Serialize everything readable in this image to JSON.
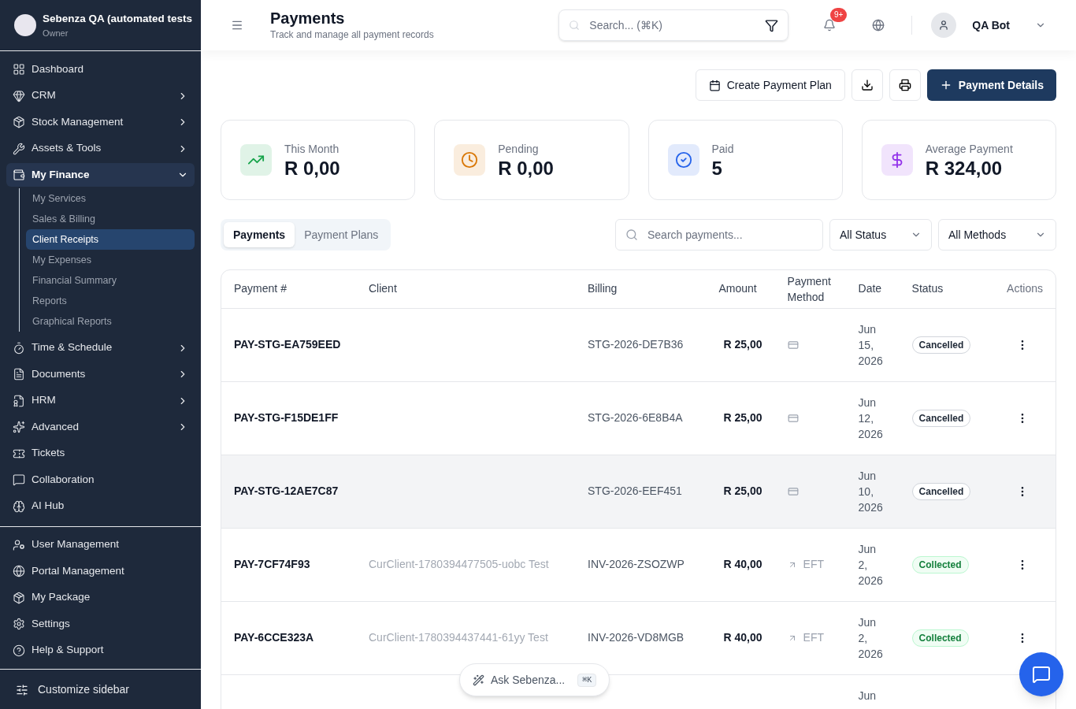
{
  "sidebar": {
    "org": {
      "name": "Sebenza QA (automated tests",
      "role": "Owner"
    },
    "items": [
      {
        "kind": "dashboard",
        "label": "Dashboard",
        "selected": false
      },
      {
        "kind": "crm",
        "label": "CRM",
        "expanded": false,
        "selected": false
      },
      {
        "kind": "stock",
        "label": "Stock Management",
        "expanded": false,
        "selected": false
      },
      {
        "kind": "assets",
        "label": "Assets & Tools",
        "expanded": false,
        "selected": false
      },
      {
        "kind": "finance",
        "label": "My Finance",
        "expanded": true,
        "selected": true,
        "children": [
          {
            "label": "My Services",
            "selected": false
          },
          {
            "label": "Sales & Billing",
            "selected": false
          },
          {
            "label": "Client Receipts",
            "selected": true
          },
          {
            "label": "My Expenses",
            "selected": false
          },
          {
            "label": "Financial Summary",
            "selected": false
          },
          {
            "label": "Reports",
            "selected": false
          },
          {
            "label": "Graphical Reports",
            "selected": false
          }
        ]
      },
      {
        "kind": "time",
        "label": "Time & Schedule",
        "expanded": false,
        "selected": false
      },
      {
        "kind": "documents",
        "label": "Documents",
        "expanded": false,
        "selected": false
      },
      {
        "kind": "hrm",
        "label": "HRM",
        "expanded": false,
        "selected": false
      },
      {
        "kind": "advanced",
        "label": "Advanced",
        "expanded": false,
        "selected": false
      },
      {
        "kind": "tickets",
        "label": "Tickets",
        "selected": false
      },
      {
        "kind": "collaboration",
        "label": "Collaboration",
        "selected": false
      },
      {
        "kind": "ai",
        "label": "AI Hub",
        "selected": false
      }
    ],
    "bottom_items": [
      {
        "kind": "users",
        "label": "User Management",
        "selected": false
      },
      {
        "kind": "portal",
        "label": "Portal Management",
        "selected": false
      },
      {
        "kind": "package",
        "label": "My Package",
        "selected": false
      },
      {
        "kind": "settings",
        "label": "Settings",
        "selected": false
      },
      {
        "kind": "help",
        "label": "Help & Support",
        "selected": false
      }
    ],
    "customize": "Customize sidebar"
  },
  "header": {
    "title": "Payments",
    "subtitle": "Track and manage all payment records",
    "search_placeholder": "Search... (⌘K)",
    "notification_badge": "9+",
    "user": "QA Bot"
  },
  "actions": {
    "create_plan": "Create Payment Plan",
    "primary": "Payment Details"
  },
  "stats": [
    {
      "kind": "trend",
      "color": "#16a34a",
      "label": "This Month",
      "value": "R 0,00"
    },
    {
      "kind": "clock",
      "color": "#d97706",
      "label": "Pending",
      "value": "R 0,00"
    },
    {
      "kind": "check",
      "color": "#2563eb",
      "label": "Paid",
      "value": "5"
    },
    {
      "kind": "dollar",
      "color": "#9333ea",
      "label": "Average Payment",
      "value": "R 324,00"
    }
  ],
  "tabs": [
    {
      "label": "Payments",
      "selected": true
    },
    {
      "label": "Payment Plans",
      "selected": false
    }
  ],
  "filters": {
    "search_placeholder": "Search payments...",
    "status": "All Status",
    "method": "All Methods"
  },
  "table": {
    "columns": [
      "Payment #",
      "Client",
      "Billing",
      "Amount",
      "Payment Method",
      "Date",
      "Status",
      "Actions"
    ],
    "rows": [
      {
        "payment": "PAY-STG-EA759EED",
        "billing": "STG-2026-DE7B36",
        "amount": "R 25,00",
        "method": {
          "kind": "card"
        },
        "date": "Jun 15, 2026",
        "status": {
          "kind": "cancelled",
          "label": "Cancelled"
        },
        "selected": false
      },
      {
        "payment": "PAY-STG-F15DE1FF",
        "billing": "STG-2026-6E8B4A",
        "amount": "R 25,00",
        "method": {
          "kind": "card"
        },
        "date": "Jun 12, 2026",
        "status": {
          "kind": "cancelled",
          "label": "Cancelled"
        },
        "selected": false
      },
      {
        "payment": "PAY-STG-12AE7C87",
        "billing": "STG-2026-EEF451",
        "amount": "R 25,00",
        "method": {
          "kind": "card"
        },
        "date": "Jun 10, 2026",
        "status": {
          "kind": "cancelled",
          "label": "Cancelled"
        },
        "selected": true
      },
      {
        "payment": "PAY-7CF74F93",
        "client": "CurClient-1780394477505-uobc Test",
        "billing": "INV-2026-ZSOZWP",
        "amount": "R 40,00",
        "method": {
          "kind": "transfer",
          "label": "EFT"
        },
        "date": "Jun 2, 2026",
        "status": {
          "kind": "collected",
          "label": "Collected"
        },
        "selected": false
      },
      {
        "payment": "PAY-6CCE323A",
        "client": "CurClient-1780394437441-61yy Test",
        "billing": "INV-2026-VD8MGB",
        "amount": "R 40,00",
        "method": {
          "kind": "transfer",
          "label": "EFT"
        },
        "date": "Jun 2, 2026",
        "status": {
          "kind": "collected",
          "label": "Collected"
        },
        "selected": false
      },
      {
        "date": "Jun",
        "selected": false
      }
    ]
  },
  "assistant": {
    "label": "Ask Sebenza...",
    "shortcut": "⌘K"
  }
}
